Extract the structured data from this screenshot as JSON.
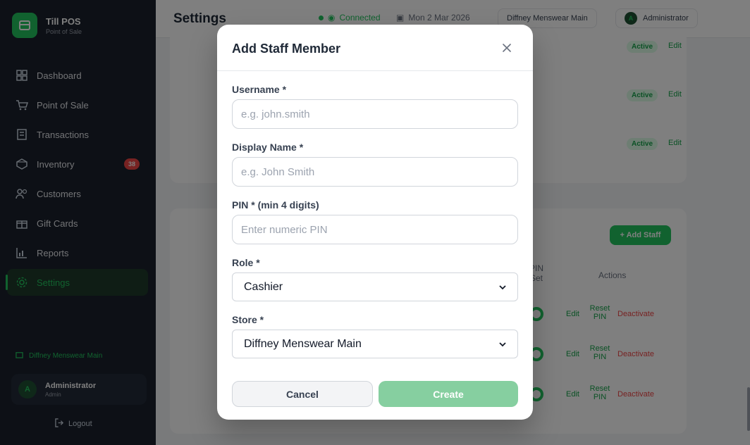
{
  "app": {
    "name": "Till POS",
    "subtitle": "Point of Sale"
  },
  "sidebar": {
    "items": [
      {
        "label": "Dashboard",
        "icon": "dashboard-icon"
      },
      {
        "label": "Point of Sale",
        "icon": "cart-icon"
      },
      {
        "label": "Transactions",
        "icon": "receipt-icon"
      },
      {
        "label": "Inventory",
        "icon": "box-icon",
        "badge": "38"
      },
      {
        "label": "Customers",
        "icon": "users-icon"
      },
      {
        "label": "Gift Cards",
        "icon": "gift-icon"
      },
      {
        "label": "Reports",
        "icon": "chart-icon"
      },
      {
        "label": "Settings",
        "icon": "gear-icon",
        "active": true
      }
    ],
    "store": "Diffney Menswear Main",
    "user": {
      "initial": "A",
      "name": "Administrator",
      "role": "Admin"
    },
    "logout_label": "Logout"
  },
  "topbar": {
    "title": "Settings",
    "connection": "Connected",
    "date": "Mon 2 Mar 2026",
    "store": "Diffney Menswear Main",
    "user_initial": "A",
    "user": "Administrator"
  },
  "background": {
    "status_labels": [
      "Active",
      "Active",
      "Active"
    ],
    "edit_label": "Edit",
    "add_staff_label": "+ Add Staff",
    "col_pin": "PIN Set",
    "col_actions": "Actions",
    "row_actions": {
      "edit": "Edit",
      "reset": "Reset PIN",
      "deactivate": "Deactivate"
    }
  },
  "modal": {
    "title": "Add Staff Member",
    "username": {
      "label": "Username *",
      "placeholder": "e.g. john.smith",
      "value": ""
    },
    "display_name": {
      "label": "Display Name *",
      "placeholder": "e.g. John Smith",
      "value": ""
    },
    "pin": {
      "label": "PIN * (min 4 digits)",
      "placeholder": "Enter numeric PIN",
      "value": ""
    },
    "role": {
      "label": "Role *",
      "selected": "Cashier"
    },
    "store": {
      "label": "Store *",
      "selected": "Diffney Menswear Main"
    },
    "cancel_label": "Cancel",
    "create_label": "Create"
  },
  "colors": {
    "accent": "#22c55e",
    "sidebar_bg": "#1a202c",
    "danger": "#ef4444",
    "create_disabled": "#86cfa0"
  }
}
